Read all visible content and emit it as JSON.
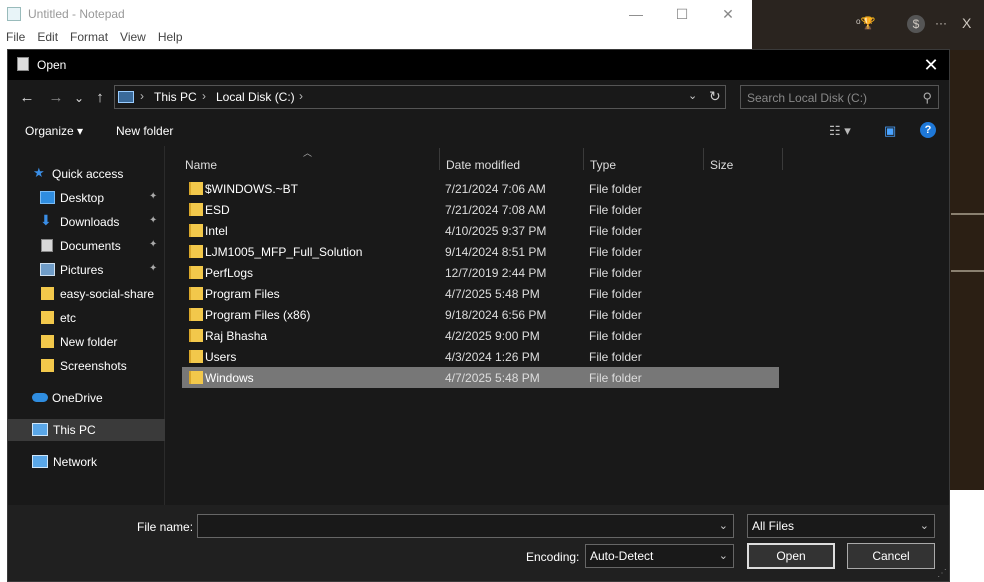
{
  "notepad": {
    "title": "Untitled - Notepad",
    "menu": [
      "File",
      "Edit",
      "Format",
      "View",
      "Help"
    ],
    "controls": {
      "minimize": "—",
      "maximize": "☐",
      "close": "✕"
    }
  },
  "background_app": {
    "icons": [
      "ᵒ🏆",
      "$",
      "···",
      "X"
    ]
  },
  "dialog": {
    "title": "Open",
    "close": "✕",
    "nav": {
      "back": "←",
      "forward": "→",
      "recent": "⌄",
      "up": "↑"
    },
    "breadcrumb": [
      "This PC",
      "Local Disk (C:)"
    ],
    "breadcrumb_sep": "›",
    "search_placeholder": "Search Local Disk (C:)",
    "toolbar": {
      "organize": "Organize ▾",
      "new_folder": "New folder",
      "view_icon": "☷ ▾",
      "preview_icon": "▣",
      "help": "?"
    },
    "sidebar": [
      {
        "label": "Quick access",
        "icon": "star-icon",
        "color": "#3a8ee6"
      },
      {
        "label": "Desktop",
        "icon": "desktop-icon",
        "color": "#2f8de0",
        "pinned": true
      },
      {
        "label": "Downloads",
        "icon": "download-icon",
        "color": "#3a8ee6",
        "pinned": true
      },
      {
        "label": "Documents",
        "icon": "documents-icon",
        "color": "#c8c8c8",
        "pinned": true
      },
      {
        "label": "Pictures",
        "icon": "pictures-icon",
        "color": "#9ab8d8",
        "pinned": true
      },
      {
        "label": "easy-social-share",
        "icon": "folder-icon",
        "color": "#f2c84b"
      },
      {
        "label": "etc",
        "icon": "folder-icon",
        "color": "#f2c84b"
      },
      {
        "label": "New folder",
        "icon": "folder-icon",
        "color": "#f2c84b"
      },
      {
        "label": "Screenshots",
        "icon": "folder-icon",
        "color": "#f2c84b"
      },
      {
        "label": "OneDrive",
        "icon": "cloud-icon",
        "color": "#2f8de0"
      },
      {
        "label": "This PC",
        "icon": "computer-icon",
        "color": "#5aa7e8",
        "selected": true
      },
      {
        "label": "Network",
        "icon": "network-icon",
        "color": "#5aa7e8"
      }
    ],
    "pin_glyph": "📌",
    "columns": {
      "name": "Name",
      "date": "Date modified",
      "type": "Type",
      "size": "Size"
    },
    "files": [
      {
        "name": "$WINDOWS.~BT",
        "date": "7/21/2024 7:06 AM",
        "type": "File folder"
      },
      {
        "name": "ESD",
        "date": "7/21/2024 7:08 AM",
        "type": "File folder"
      },
      {
        "name": "Intel",
        "date": "4/10/2025 9:37 PM",
        "type": "File folder"
      },
      {
        "name": "LJM1005_MFP_Full_Solution",
        "date": "9/14/2024 8:51 PM",
        "type": "File folder"
      },
      {
        "name": "PerfLogs",
        "date": "12/7/2019 2:44 PM",
        "type": "File folder"
      },
      {
        "name": "Program Files",
        "date": "4/7/2025 5:48 PM",
        "type": "File folder"
      },
      {
        "name": "Program Files (x86)",
        "date": "9/18/2024 6:56 PM",
        "type": "File folder"
      },
      {
        "name": "Raj Bhasha",
        "date": "4/2/2025 9:00 PM",
        "type": "File folder"
      },
      {
        "name": "Users",
        "date": "4/3/2024 1:26 PM",
        "type": "File folder"
      },
      {
        "name": "Windows",
        "date": "4/7/2025 5:48 PM",
        "type": "File folder",
        "selected": true
      }
    ],
    "footer": {
      "file_name_label": "File name:",
      "file_name_value": "",
      "file_type": "All Files",
      "encoding_label": "Encoding:",
      "encoding_value": "Auto-Detect",
      "open": "Open",
      "cancel": "Cancel"
    }
  }
}
